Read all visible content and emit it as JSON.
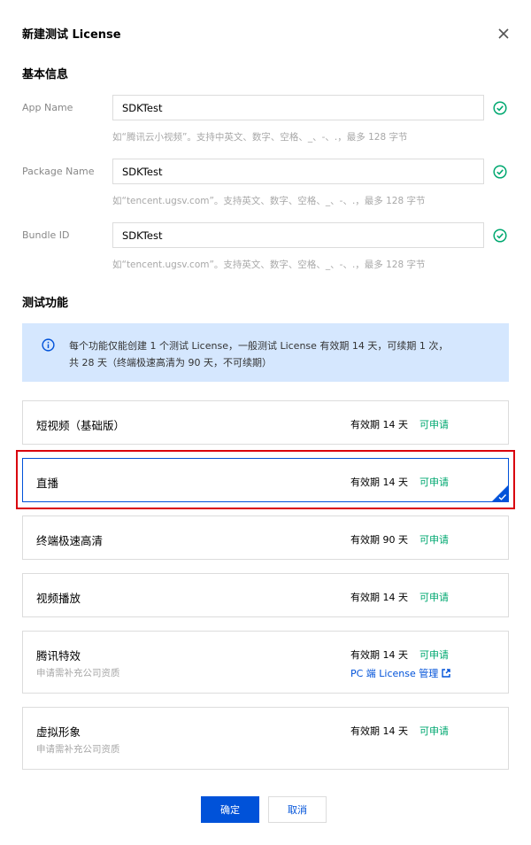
{
  "dialog": {
    "title": "新建测试 License",
    "close_icon": "close-icon"
  },
  "basic_info": {
    "section_title": "基本信息",
    "fields": [
      {
        "label": "App Name",
        "value": "SDKTest",
        "hint": "如“腾讯云小视频”。支持中英文、数字、空格、_、-、.，最多 128 字节"
      },
      {
        "label": "Package Name",
        "value": "SDKTest",
        "hint": "如“tencent.ugsv.com”。支持英文、数字、空格、_、-、.，最多 128 字节"
      },
      {
        "label": "Bundle ID",
        "value": "SDKTest",
        "hint": "如“tencent.ugsv.com”。支持英文、数字、空格、_、-、.，最多 128 字节"
      }
    ],
    "check_icon": "check-circle-icon"
  },
  "test_features": {
    "section_title": "测试功能",
    "notice_line1": "每个功能仅能创建 1 个测试 License，一般测试 License 有效期 14 天，可续期 1 次，",
    "notice_line2": "共 28 天（终端极速高清为 90 天，不可续期）",
    "items": [
      {
        "name": "短视频（基础版）",
        "validity": "有效期 14 天",
        "status": "可申请"
      },
      {
        "name": "直播",
        "validity": "有效期 14 天",
        "status": "可申请",
        "selected": true
      },
      {
        "name": "终端极速高清",
        "validity": "有效期 90 天",
        "status": "可申请"
      },
      {
        "name": "视频播放",
        "validity": "有效期 14 天",
        "status": "可申请"
      },
      {
        "name": "腾讯特效",
        "sub": "申请需补充公司资质",
        "validity": "有效期 14 天",
        "status": "可申请",
        "link": "PC 端 License 管理"
      },
      {
        "name": "虚拟形象",
        "sub": "申请需补充公司资质",
        "validity": "有效期 14 天",
        "status": "可申请"
      }
    ]
  },
  "footer": {
    "confirm_label": "确定",
    "cancel_label": "取消"
  },
  "colors": {
    "primary": "#0052d9",
    "success": "#00a870",
    "notice_bg": "#d5e7fe",
    "highlight": "#d9000d"
  }
}
